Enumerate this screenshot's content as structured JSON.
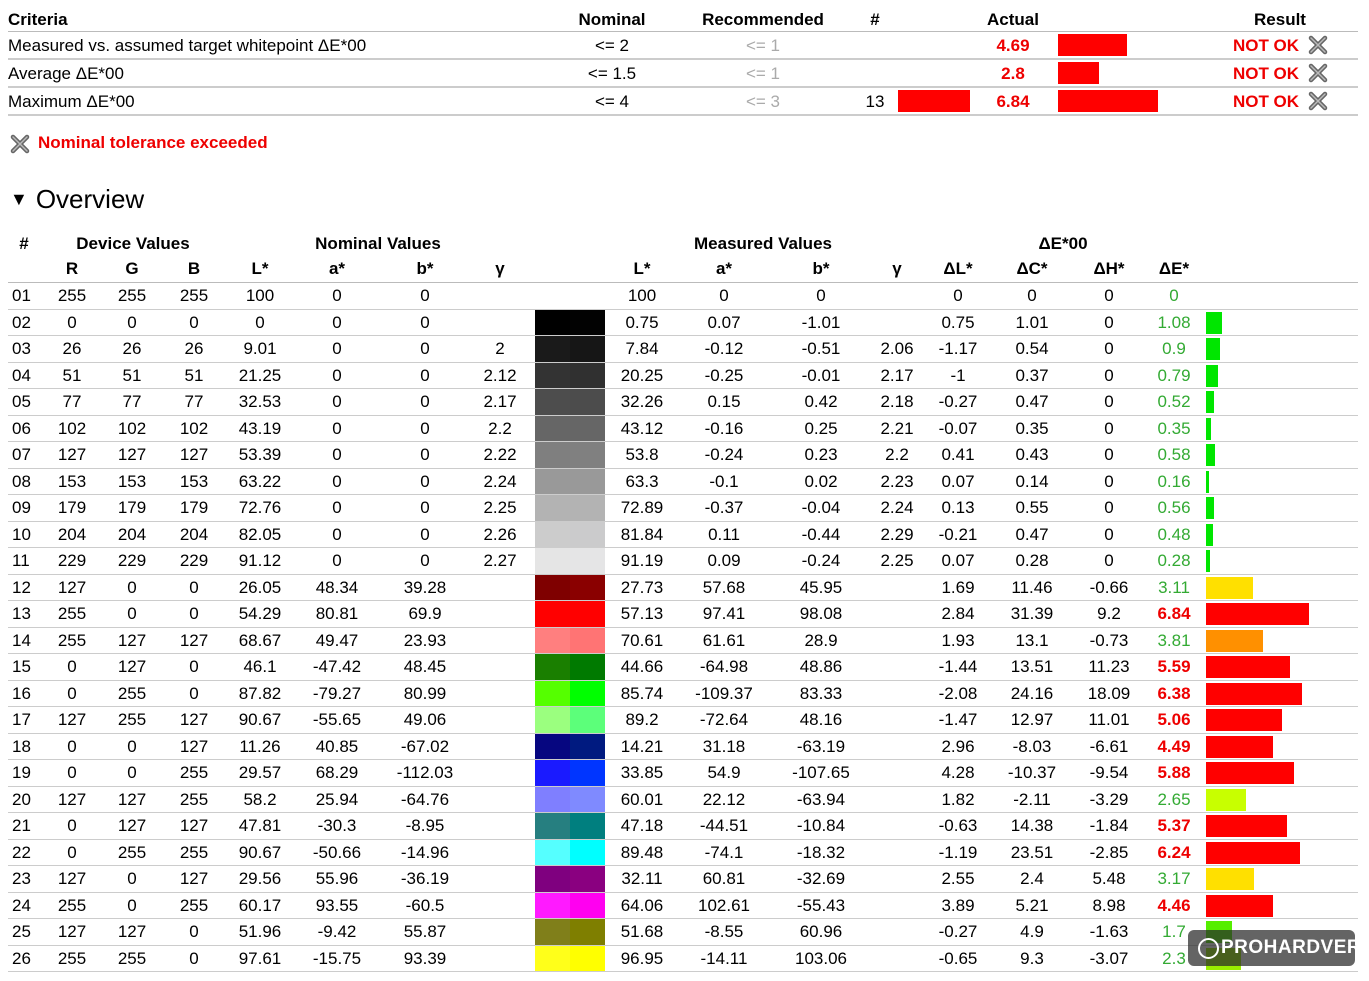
{
  "criteria": {
    "headers": {
      "criteria": "Criteria",
      "nominal": "Nominal",
      "recommended": "Recommended",
      "num": "#",
      "actual": "Actual",
      "result": "Result"
    },
    "rows": [
      {
        "label": "Measured vs. assumed target whitepoint ΔE*00",
        "nominal": "<= 2",
        "recommended": "<= 1",
        "num": "",
        "actual": "4.69",
        "result": "NOT OK",
        "actual_fraction": 0.52
      },
      {
        "label": "Average ΔE*00",
        "nominal": "<= 1.5",
        "recommended": "<= 1",
        "num": "",
        "actual": "2.8",
        "result": "NOT OK",
        "actual_fraction": 0.31
      },
      {
        "label": "Maximum ΔE*00",
        "nominal": "<= 4",
        "recommended": "<= 3",
        "num": "13",
        "actual": "6.84",
        "result": "NOT OK",
        "actual_fraction": 0.76
      }
    ]
  },
  "notice": {
    "text": "Nominal tolerance exceeded",
    "icon": "x-icon"
  },
  "overview": {
    "title": "Overview"
  },
  "table": {
    "group_headers": {
      "num": "#",
      "device": "Device Values",
      "nominal": "Nominal Values",
      "measured": "Measured Values",
      "delta": "ΔE*00"
    },
    "columns": {
      "R": "R",
      "G": "G",
      "B": "B",
      "L": "L*",
      "a": "a*",
      "b": "b*",
      "gamma": "γ",
      "mL": "L*",
      "ma": "a*",
      "mb": "b*",
      "mgamma": "γ",
      "dL": "ΔL*",
      "dC": "ΔC*",
      "dH": "ΔH*",
      "dE": "ΔE*"
    },
    "rows": [
      {
        "n": "01",
        "R": "255",
        "G": "255",
        "B": "255",
        "L": "100",
        "a": "0",
        "b": "0",
        "g": "",
        "mL": "100",
        "ma": "0",
        "mb": "0",
        "mg": "",
        "dL": "0",
        "dC": "0",
        "dH": "0",
        "dE": "0",
        "nom": "#ffffff",
        "meas": "#ffffff",
        "bar": "#00e600"
      },
      {
        "n": "02",
        "R": "0",
        "G": "0",
        "B": "0",
        "L": "0",
        "a": "0",
        "b": "0",
        "g": "",
        "mL": "0.75",
        "ma": "0.07",
        "mb": "-1.01",
        "mg": "",
        "dL": "0.75",
        "dC": "1.01",
        "dH": "0",
        "dE": "1.08",
        "nom": "#000000",
        "meas": "#020202",
        "bar": "#00e600"
      },
      {
        "n": "03",
        "R": "26",
        "G": "26",
        "B": "26",
        "L": "9.01",
        "a": "0",
        "b": "0",
        "g": "2",
        "mL": "7.84",
        "ma": "-0.12",
        "mb": "-0.51",
        "mg": "2.06",
        "dL": "-1.17",
        "dC": "0.54",
        "dH": "0",
        "dE": "0.9",
        "nom": "#1a1a1a",
        "meas": "#161616",
        "bar": "#00e600"
      },
      {
        "n": "04",
        "R": "51",
        "G": "51",
        "B": "51",
        "L": "21.25",
        "a": "0",
        "b": "0",
        "g": "2.12",
        "mL": "20.25",
        "ma": "-0.25",
        "mb": "-0.01",
        "mg": "2.17",
        "dL": "-1",
        "dC": "0.37",
        "dH": "0",
        "dE": "0.79",
        "nom": "#333333",
        "meas": "#303030",
        "bar": "#00e600"
      },
      {
        "n": "05",
        "R": "77",
        "G": "77",
        "B": "77",
        "L": "32.53",
        "a": "0",
        "b": "0",
        "g": "2.17",
        "mL": "32.26",
        "ma": "0.15",
        "mb": "0.42",
        "mg": "2.18",
        "dL": "-0.27",
        "dC": "0.47",
        "dH": "0",
        "dE": "0.52",
        "nom": "#4d4d4d",
        "meas": "#4c4c4c",
        "bar": "#00e600"
      },
      {
        "n": "06",
        "R": "102",
        "G": "102",
        "B": "102",
        "L": "43.19",
        "a": "0",
        "b": "0",
        "g": "2.2",
        "mL": "43.12",
        "ma": "-0.16",
        "mb": "0.25",
        "mg": "2.21",
        "dL": "-0.07",
        "dC": "0.35",
        "dH": "0",
        "dE": "0.35",
        "nom": "#666666",
        "meas": "#666666",
        "bar": "#00e600"
      },
      {
        "n": "07",
        "R": "127",
        "G": "127",
        "B": "127",
        "L": "53.39",
        "a": "0",
        "b": "0",
        "g": "2.22",
        "mL": "53.8",
        "ma": "-0.24",
        "mb": "0.23",
        "mg": "2.2",
        "dL": "0.41",
        "dC": "0.43",
        "dH": "0",
        "dE": "0.58",
        "nom": "#7f7f7f",
        "meas": "#808080",
        "bar": "#00e600"
      },
      {
        "n": "08",
        "R": "153",
        "G": "153",
        "B": "153",
        "L": "63.22",
        "a": "0",
        "b": "0",
        "g": "2.24",
        "mL": "63.3",
        "ma": "-0.1",
        "mb": "0.02",
        "mg": "2.23",
        "dL": "0.07",
        "dC": "0.14",
        "dH": "0",
        "dE": "0.16",
        "nom": "#999999",
        "meas": "#999999",
        "bar": "#00e600"
      },
      {
        "n": "09",
        "R": "179",
        "G": "179",
        "B": "179",
        "L": "72.76",
        "a": "0",
        "b": "0",
        "g": "2.25",
        "mL": "72.89",
        "ma": "-0.37",
        "mb": "-0.04",
        "mg": "2.24",
        "dL": "0.13",
        "dC": "0.55",
        "dH": "0",
        "dE": "0.56",
        "nom": "#b3b3b3",
        "meas": "#b3b3b3",
        "bar": "#00e600"
      },
      {
        "n": "10",
        "R": "204",
        "G": "204",
        "B": "204",
        "L": "82.05",
        "a": "0",
        "b": "0",
        "g": "2.26",
        "mL": "81.84",
        "ma": "0.11",
        "mb": "-0.44",
        "mg": "2.29",
        "dL": "-0.21",
        "dC": "0.47",
        "dH": "0",
        "dE": "0.48",
        "nom": "#cccccc",
        "meas": "#cbcbcc",
        "bar": "#00e600"
      },
      {
        "n": "11",
        "R": "229",
        "G": "229",
        "B": "229",
        "L": "91.12",
        "a": "0",
        "b": "0",
        "g": "2.27",
        "mL": "91.19",
        "ma": "0.09",
        "mb": "-0.24",
        "mg": "2.25",
        "dL": "0.07",
        "dC": "0.28",
        "dH": "0",
        "dE": "0.28",
        "nom": "#e5e5e5",
        "meas": "#e5e5e6",
        "bar": "#00e600"
      },
      {
        "n": "12",
        "R": "127",
        "G": "0",
        "B": "0",
        "L": "26.05",
        "a": "48.34",
        "b": "39.28",
        "g": "",
        "mL": "27.73",
        "ma": "57.68",
        "mb": "45.95",
        "mg": "",
        "dL": "1.69",
        "dC": "11.46",
        "dH": "-0.66",
        "dE": "3.11",
        "nom": "#7f0000",
        "meas": "#8a0000",
        "bar": "#ffe000"
      },
      {
        "n": "13",
        "R": "255",
        "G": "0",
        "B": "0",
        "L": "54.29",
        "a": "80.81",
        "b": "69.9",
        "g": "",
        "mL": "57.13",
        "ma": "97.41",
        "mb": "98.08",
        "mg": "",
        "dL": "2.84",
        "dC": "31.39",
        "dH": "9.2",
        "dE": "6.84",
        "nom": "#ff0000",
        "meas": "#ff0000",
        "bar": "#ff0000"
      },
      {
        "n": "14",
        "R": "255",
        "G": "127",
        "B": "127",
        "L": "68.67",
        "a": "49.47",
        "b": "23.93",
        "g": "",
        "mL": "70.61",
        "ma": "61.61",
        "mb": "28.9",
        "mg": "",
        "dL": "1.93",
        "dC": "13.1",
        "dH": "-0.73",
        "dE": "3.81",
        "nom": "#ff7f7f",
        "meas": "#ff7474",
        "bar": "#ff9000"
      },
      {
        "n": "15",
        "R": "0",
        "G": "127",
        "B": "0",
        "L": "46.1",
        "a": "-47.42",
        "b": "48.45",
        "g": "",
        "mL": "44.66",
        "ma": "-64.98",
        "mb": "48.86",
        "mg": "",
        "dL": "-1.44",
        "dC": "13.51",
        "dH": "11.23",
        "dE": "5.59",
        "nom": "#1a7f00",
        "meas": "#007a00",
        "bar": "#ff0000"
      },
      {
        "n": "16",
        "R": "0",
        "G": "255",
        "B": "0",
        "L": "87.82",
        "a": "-79.27",
        "b": "80.99",
        "g": "",
        "mL": "85.74",
        "ma": "-109.37",
        "mb": "83.33",
        "mg": "",
        "dL": "-2.08",
        "dC": "24.16",
        "dH": "18.09",
        "dE": "6.38",
        "nom": "#55ff00",
        "meas": "#00ff00",
        "bar": "#ff0000"
      },
      {
        "n": "17",
        "R": "127",
        "G": "255",
        "B": "127",
        "L": "90.67",
        "a": "-55.65",
        "b": "49.06",
        "g": "",
        "mL": "89.2",
        "ma": "-72.64",
        "mb": "48.16",
        "mg": "",
        "dL": "-1.47",
        "dC": "12.97",
        "dH": "11.01",
        "dE": "5.06",
        "nom": "#9bff7f",
        "meas": "#5cff7a",
        "bar": "#ff0000"
      },
      {
        "n": "18",
        "R": "0",
        "G": "0",
        "B": "127",
        "L": "11.26",
        "a": "40.85",
        "b": "-67.02",
        "g": "",
        "mL": "14.21",
        "ma": "31.18",
        "mb": "-63.19",
        "mg": "",
        "dL": "2.96",
        "dC": "-8.03",
        "dH": "-6.61",
        "dE": "4.49",
        "nom": "#060680",
        "meas": "#001a80",
        "bar": "#ff0000"
      },
      {
        "n": "19",
        "R": "0",
        "G": "0",
        "B": "255",
        "L": "29.57",
        "a": "68.29",
        "b": "-112.03",
        "g": "",
        "mL": "33.85",
        "ma": "54.9",
        "mb": "-107.65",
        "mg": "",
        "dL": "4.28",
        "dC": "-10.37",
        "dH": "-9.54",
        "dE": "5.88",
        "nom": "#1a1aff",
        "meas": "#0035ff",
        "bar": "#ff0000"
      },
      {
        "n": "20",
        "R": "127",
        "G": "127",
        "B": "255",
        "L": "58.2",
        "a": "25.94",
        "b": "-64.76",
        "g": "",
        "mL": "60.01",
        "ma": "22.12",
        "mb": "-63.94",
        "mg": "",
        "dL": "1.82",
        "dC": "-2.11",
        "dH": "-3.29",
        "dE": "2.65",
        "nom": "#7f7fff",
        "meas": "#7f8aff",
        "bar": "#c8ff00"
      },
      {
        "n": "21",
        "R": "0",
        "G": "127",
        "B": "127",
        "L": "47.81",
        "a": "-30.3",
        "b": "-8.95",
        "g": "",
        "mL": "47.18",
        "ma": "-44.51",
        "mb": "-10.84",
        "mg": "",
        "dL": "-0.63",
        "dC": "14.38",
        "dH": "-1.84",
        "dE": "5.37",
        "nom": "#267f80",
        "meas": "#007f7f",
        "bar": "#ff0000"
      },
      {
        "n": "22",
        "R": "0",
        "G": "255",
        "B": "255",
        "L": "90.67",
        "a": "-50.66",
        "b": "-14.96",
        "g": "",
        "mL": "89.48",
        "ma": "-74.1",
        "mb": "-18.32",
        "mg": "",
        "dL": "-1.19",
        "dC": "23.51",
        "dH": "-2.85",
        "dE": "6.24",
        "nom": "#55ffff",
        "meas": "#00ffff",
        "bar": "#ff0000"
      },
      {
        "n": "23",
        "R": "127",
        "G": "0",
        "B": "127",
        "L": "29.56",
        "a": "55.96",
        "b": "-36.19",
        "g": "",
        "mL": "32.11",
        "ma": "60.81",
        "mb": "-32.69",
        "mg": "",
        "dL": "2.55",
        "dC": "2.4",
        "dH": "5.48",
        "dE": "3.17",
        "nom": "#7f007f",
        "meas": "#8a0080",
        "bar": "#ffe000"
      },
      {
        "n": "24",
        "R": "255",
        "G": "0",
        "B": "255",
        "L": "60.17",
        "a": "93.55",
        "b": "-60.5",
        "g": "",
        "mL": "64.06",
        "ma": "102.61",
        "mb": "-55.43",
        "mg": "",
        "dL": "3.89",
        "dC": "5.21",
        "dH": "8.98",
        "dE": "4.46",
        "nom": "#ff1aff",
        "meas": "#ff00f0",
        "bar": "#ff0000"
      },
      {
        "n": "25",
        "R": "127",
        "G": "127",
        "B": "0",
        "L": "51.96",
        "a": "-9.42",
        "b": "55.87",
        "g": "",
        "mL": "51.68",
        "ma": "-8.55",
        "mb": "60.96",
        "mg": "",
        "dL": "-0.27",
        "dC": "4.9",
        "dH": "-1.63",
        "dE": "1.7",
        "nom": "#807f1a",
        "meas": "#7f7f00",
        "bar": "#55ee00"
      },
      {
        "n": "26",
        "R": "255",
        "G": "255",
        "B": "0",
        "L": "97.61",
        "a": "-15.75",
        "b": "93.39",
        "g": "",
        "mL": "96.95",
        "ma": "-14.11",
        "mb": "103.06",
        "mg": "",
        "dL": "-0.65",
        "dC": "9.3",
        "dH": "-3.07",
        "dE": "2.3",
        "nom": "#ffff1a",
        "meas": "#ffff00",
        "bar": "#99ee00"
      }
    ]
  },
  "watermark": {
    "text": "PROHARDVER!"
  },
  "colors": {
    "fail": "#ee0000",
    "pass": "#33aa33",
    "bar_red": "#ff0000"
  }
}
